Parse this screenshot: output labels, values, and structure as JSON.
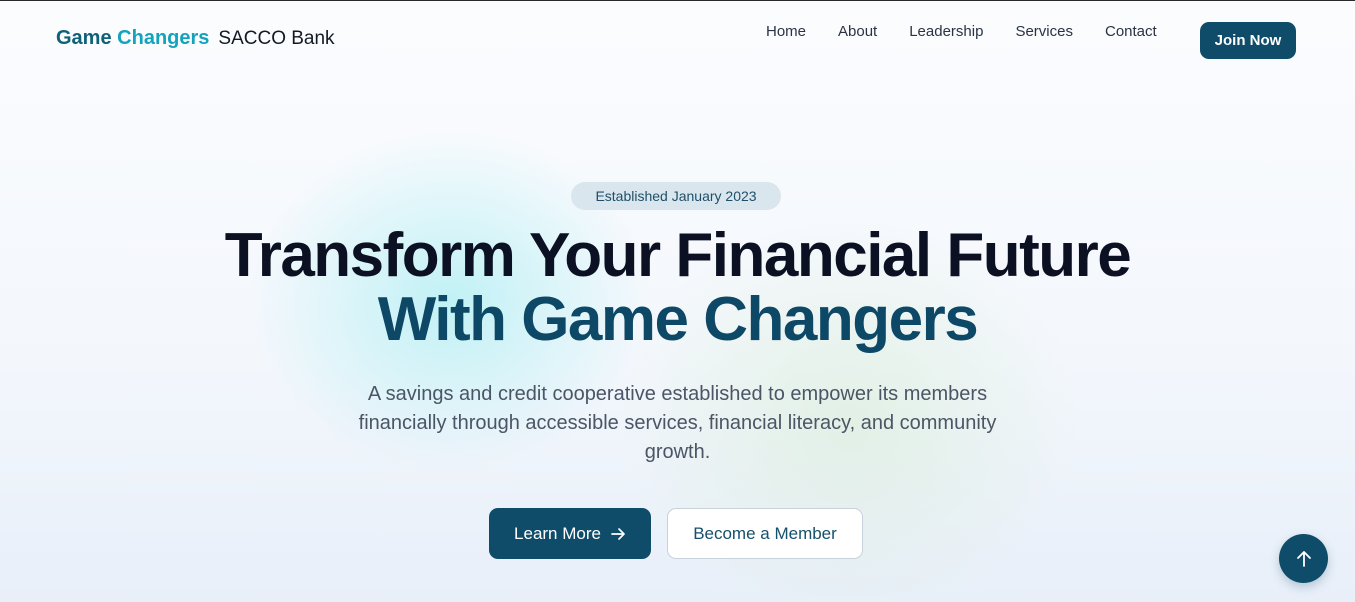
{
  "header": {
    "brand_name_primary": "Game ",
    "brand_name_accent": "Changers",
    "brand_suffix": "SACCO Bank",
    "nav": [
      {
        "label": "Home"
      },
      {
        "label": "About"
      },
      {
        "label": "Leadership"
      },
      {
        "label": "Services"
      },
      {
        "label": "Contact"
      }
    ],
    "cta_label": "Join Now"
  },
  "hero": {
    "badge": "Established January 2023",
    "title_line1": "Transform Your Financial Future",
    "title_line2": "With Game Changers",
    "description": "A savings and credit cooperative established to empower its members financially through accessible services, financial literacy, and community growth.",
    "primary_button": "Learn More",
    "secondary_button": "Become a Member"
  },
  "icons": {
    "learn_more": "arrow-right-icon",
    "scroll_top": "arrow-up-icon"
  },
  "colors": {
    "brand_primary": "#0f4c6a",
    "brand_accent": "#13a3bd",
    "heading_dark": "#0b1122",
    "heading_teal": "#0d4866",
    "badge_bg": "#dae6ee"
  }
}
